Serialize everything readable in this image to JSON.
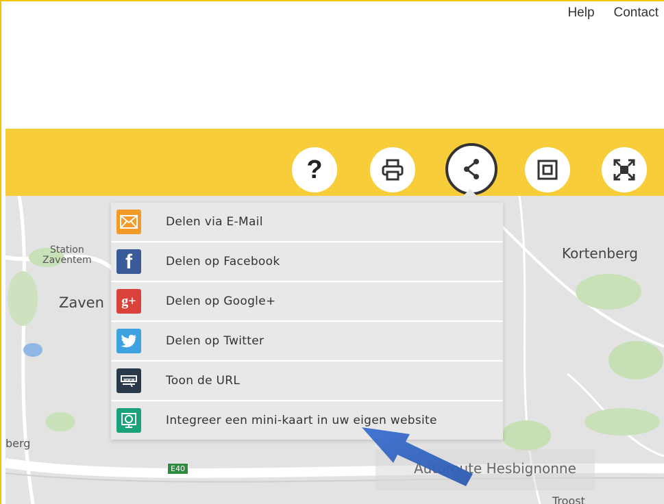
{
  "header": {
    "links": {
      "help": "Help",
      "contact": "Contact"
    }
  },
  "toolbar": {
    "buttons": [
      {
        "name": "help",
        "icon": "question-icon"
      },
      {
        "name": "print",
        "icon": "print-icon"
      },
      {
        "name": "share",
        "icon": "share-icon",
        "active": true
      },
      {
        "name": "frame",
        "icon": "frame-icon"
      },
      {
        "name": "fullscreen",
        "icon": "fullscreen-icon"
      }
    ],
    "color": "#f8cd3a"
  },
  "share_menu": {
    "items": [
      {
        "label": "Delen via E-Mail",
        "icon": "email-icon",
        "color": "#f29b2b"
      },
      {
        "label": "Delen op Facebook",
        "icon": "facebook-icon",
        "color": "#3b5a9a"
      },
      {
        "label": "Delen op Google+",
        "icon": "google-plus-icon",
        "color": "#d9413b"
      },
      {
        "label": "Delen op Twitter",
        "icon": "twitter-icon",
        "color": "#3da2df"
      },
      {
        "label": "Toon de URL",
        "icon": "url-icon",
        "color": "#2b3a4a"
      },
      {
        "label": "Integreer een mini-kaart in uw eigen website",
        "icon": "embed-map-icon",
        "color": "#1aa37a"
      }
    ]
  },
  "map": {
    "labels": {
      "station": "Station\nZaventem",
      "zaventem": "Zaven",
      "kortenberg": "Kortenberg",
      "berg": "berg",
      "road_badge": "E40",
      "autoroute": "Autoroute Hesbignonne",
      "troost": "Troost"
    }
  },
  "annotation": {
    "arrow_color": "#3a6fd0"
  }
}
